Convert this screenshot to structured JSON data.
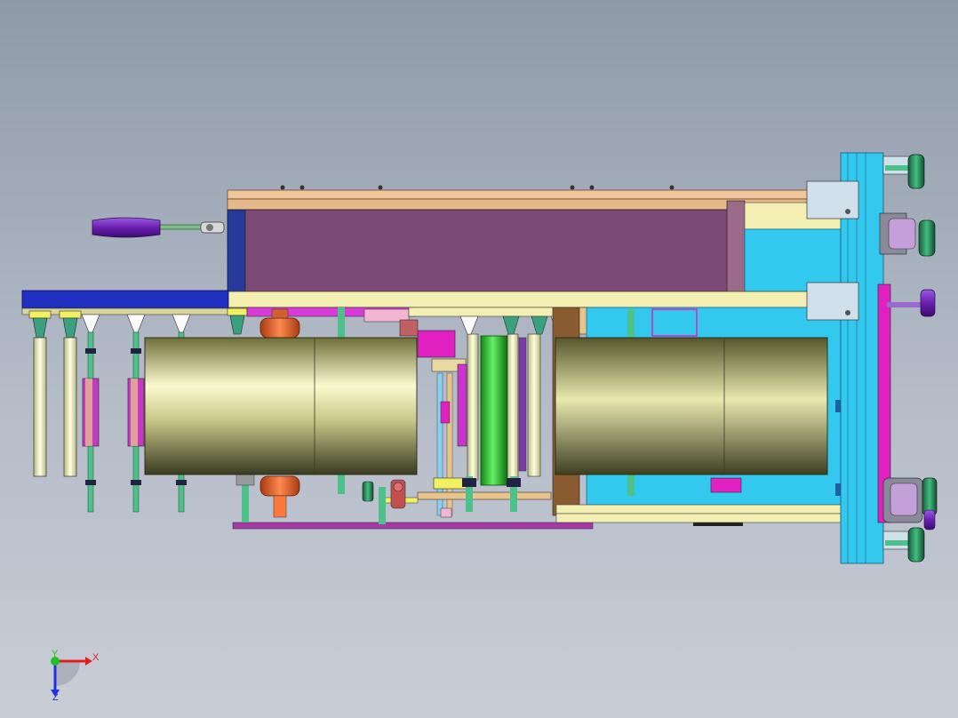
{
  "viewport": {
    "background_top": "#8f9aa9",
    "background_bottom": "#c9cdd6"
  },
  "triad": {
    "x_label": "X",
    "y_label": "Y",
    "z_label": "Z",
    "x_color": "#e02020",
    "y_color": "#22c022",
    "z_color": "#2030e0"
  },
  "palette": {
    "frame_tan": "#e8c48a",
    "frame_cream": "#f3eeb2",
    "hopper_plum": "#7a4a78",
    "blue_bar": "#1f2fc0",
    "cyan_frame": "#33c9ee",
    "roller_gold": "#b7b66a",
    "orange_bearing": "#e0652a",
    "magenta": "#e020c0",
    "green_roller": "#2fd02f",
    "purple_handle": "#6b1fb0",
    "teal_knob": "#2a9a6a"
  }
}
